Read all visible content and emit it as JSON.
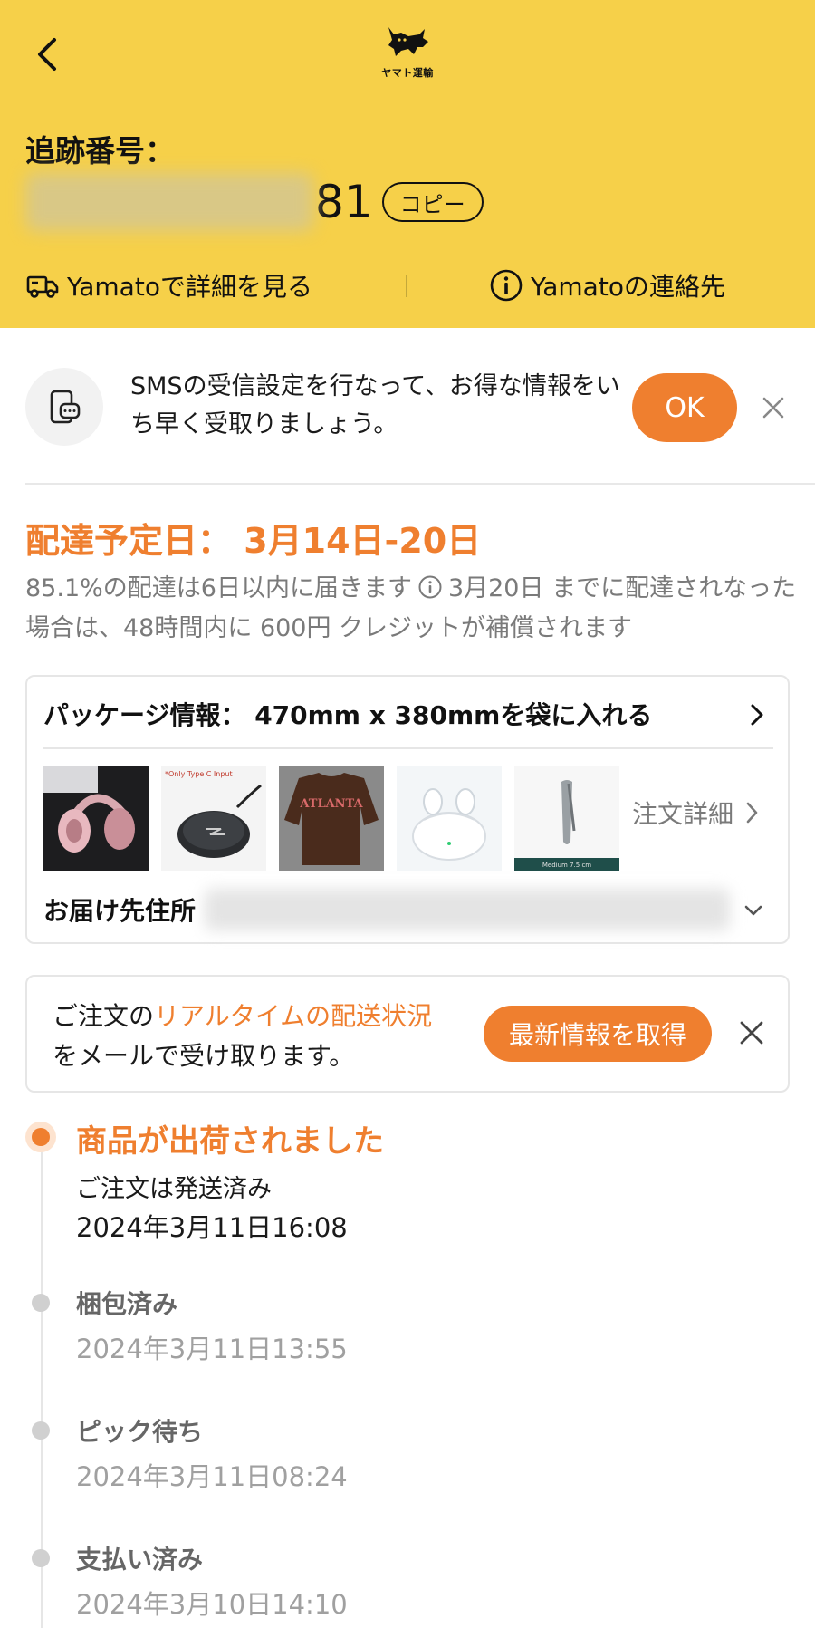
{
  "header": {
    "logo_text": "ヤマト運輸",
    "tracking_label": "追跡番号：",
    "tracking_suffix": "81",
    "copy_label": "コピー",
    "link_details": "Yamatoで詳細を見る",
    "link_contact": "Yamatoの連絡先",
    "bg_color": "#f6d049"
  },
  "sms_banner": {
    "text": "SMSの受信設定を行なって、お得な情報をいち早く受取りましょう。",
    "ok_label": "OK"
  },
  "delivery": {
    "title": "配達予定日： 3月14日-20日",
    "desc_part1": "85.1%の配達は6日以内に届きます",
    "desc_part2": "3月20日 までに配達されなった場合は、48時間内に 600円 クレジットが補償されます"
  },
  "package": {
    "header": "パッケージ情報： 470mm x 380mmを袋に入れる",
    "thumbnails": [
      "pink-headphones",
      "wireless-charger",
      "brown-sweatshirt",
      "white-earbuds",
      "nail-clipper"
    ],
    "thumb_caption_charger": "*Only Type C Input",
    "thumb_caption_sweatshirt": "ATLANTA",
    "thumb_caption_clipper": "Medium 7.5 cm",
    "order_detail_label": "注文詳細",
    "address_label": "お届け先住所"
  },
  "email_card": {
    "text_prefix": "ご注文の",
    "text_accent": "リアルタイムの配送状況",
    "text_suffix": "をメールで受け取ります。",
    "button_label": "最新情報を取得"
  },
  "timeline": [
    {
      "title": "商品が出荷されました",
      "subtitle": "ご注文は発送済み",
      "date": "2024年3月11日16:08",
      "active": true
    },
    {
      "title": "梱包済み",
      "date": "2024年3月11日13:55"
    },
    {
      "title": "ピック待ち",
      "date": "2024年3月11日08:24"
    },
    {
      "title": "支払い済み",
      "date": "2024年3月10日14:10"
    }
  ],
  "colors": {
    "accent": "#ef7f2f",
    "header": "#f6d049"
  }
}
